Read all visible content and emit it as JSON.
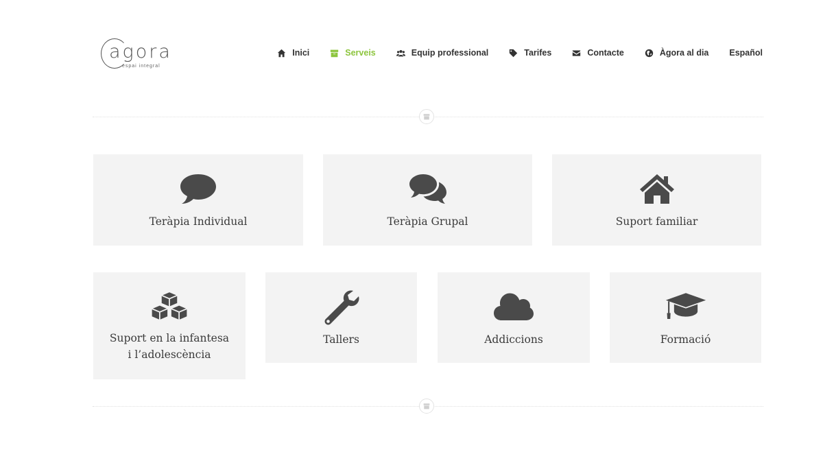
{
  "logo": {
    "word": "agora",
    "tagline": "espai integral"
  },
  "nav": {
    "items": [
      {
        "label": "Inici",
        "icon": "home-icon"
      },
      {
        "label": "Serveis",
        "icon": "archive-icon",
        "active": true
      },
      {
        "label": "Equip professional",
        "icon": "users-icon"
      },
      {
        "label": "Tarifes",
        "icon": "tag-icon"
      },
      {
        "label": "Contacte",
        "icon": "envelope-icon"
      },
      {
        "label": "Àgora al dia",
        "icon": "globe-icon"
      },
      {
        "label": "Español",
        "icon": ""
      }
    ]
  },
  "colors": {
    "accent": "#8dc53e",
    "card_bg": "#f3f3f3",
    "icon": "#4a4a4a"
  },
  "services": {
    "row1": [
      {
        "label": "Teràpia Individual",
        "icon": "comment-icon"
      },
      {
        "label": "Teràpia Grupal",
        "icon": "comments-icon"
      },
      {
        "label": "Suport familiar",
        "icon": "home-icon"
      }
    ],
    "row2": [
      {
        "label": "Suport en la infantesa i l’adolescència",
        "icon": "cubes-icon"
      },
      {
        "label": "Tallers",
        "icon": "wrench-icon"
      },
      {
        "label": "Addiccions",
        "icon": "cloud-icon"
      },
      {
        "label": "Formació",
        "icon": "graduation-cap-icon"
      }
    ]
  }
}
